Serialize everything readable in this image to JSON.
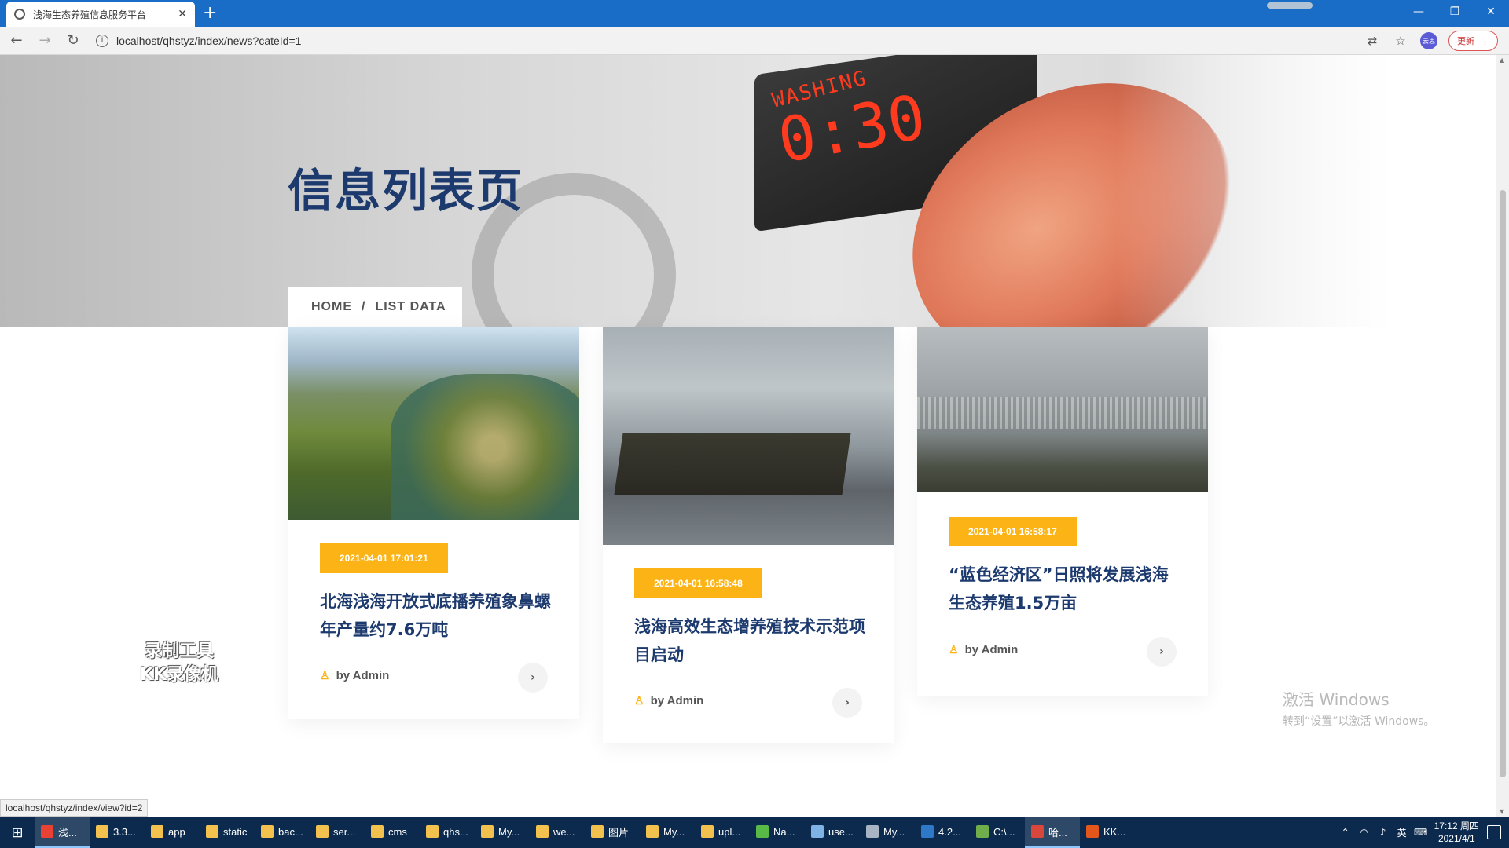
{
  "browser": {
    "tab_title": "浅海生态养殖信息服务平台",
    "url": "localhost/qhstyz/index/news?cateId=1",
    "profile_label": "云思",
    "update_label": "更新",
    "status_url": "localhost/qhstyz/index/view?id=2"
  },
  "page": {
    "title": "信息列表页",
    "breadcrumb": {
      "home": "HOME",
      "sep": "/",
      "current": "LIST DATA"
    },
    "hero_display": {
      "word": "WASHING",
      "time": "0:30"
    }
  },
  "cards": [
    {
      "date": "2021-04-01 17:01:21",
      "title": "北海浅海开放式底播养殖象鼻螺 年产量约7.6万吨",
      "author": "by Admin"
    },
    {
      "date": "2021-04-01 16:58:48",
      "title": "浅海高效生态增养殖技术示范项目启动",
      "author": "by Admin"
    },
    {
      "date": "2021-04-01 16:58:17",
      "title": "“蓝色经济区”日照将发展浅海生态养殖1.5万亩",
      "author": "by Admin"
    }
  ],
  "overlay": {
    "recorder": [
      "录制工具",
      "KK录像机"
    ],
    "activate_title": "激活 Windows",
    "activate_sub": "转到“设置”以激活 Windows。"
  },
  "taskbar": {
    "items": [
      {
        "label": "浅...",
        "icon": "chrome-icon",
        "color": "#e94235",
        "active": true
      },
      {
        "label": "3.3...",
        "icon": "folder-icon",
        "color": "#f2c14e"
      },
      {
        "label": "app",
        "icon": "folder-icon",
        "color": "#f2c14e"
      },
      {
        "label": "static",
        "icon": "folder-icon",
        "color": "#f2c14e"
      },
      {
        "label": "bac...",
        "icon": "folder-icon",
        "color": "#f2c14e"
      },
      {
        "label": "ser...",
        "icon": "folder-icon",
        "color": "#f2c14e"
      },
      {
        "label": "cms",
        "icon": "folder-icon",
        "color": "#f2c14e"
      },
      {
        "label": "qhs...",
        "icon": "folder-icon",
        "color": "#f2c14e"
      },
      {
        "label": "My...",
        "icon": "folder-icon",
        "color": "#f2c14e"
      },
      {
        "label": "we...",
        "icon": "folder-icon",
        "color": "#f2c14e"
      },
      {
        "label": "图片",
        "icon": "folder-icon",
        "color": "#f2c14e"
      },
      {
        "label": "My...",
        "icon": "folder-icon",
        "color": "#f2c14e"
      },
      {
        "label": "upl...",
        "icon": "folder-icon",
        "color": "#f2c14e"
      },
      {
        "label": "Na...",
        "icon": "navicat-icon",
        "color": "#58b947"
      },
      {
        "label": "use...",
        "icon": "window-icon",
        "color": "#7fb2e5"
      },
      {
        "label": "My...",
        "icon": "pen-icon",
        "color": "#a8b4c4"
      },
      {
        "label": "4.2...",
        "icon": "vs-icon",
        "color": "#2f78c7"
      },
      {
        "label": "C:\\...",
        "icon": "notepad-icon",
        "color": "#6fae4a"
      },
      {
        "label": "哈...",
        "icon": "app-icon",
        "color": "#d9463b",
        "active": true
      },
      {
        "label": "KK...",
        "icon": "recorder-icon",
        "color": "#e4571c"
      }
    ],
    "ime": "英",
    "time": "17:12 周四",
    "date": "2021/4/1"
  }
}
